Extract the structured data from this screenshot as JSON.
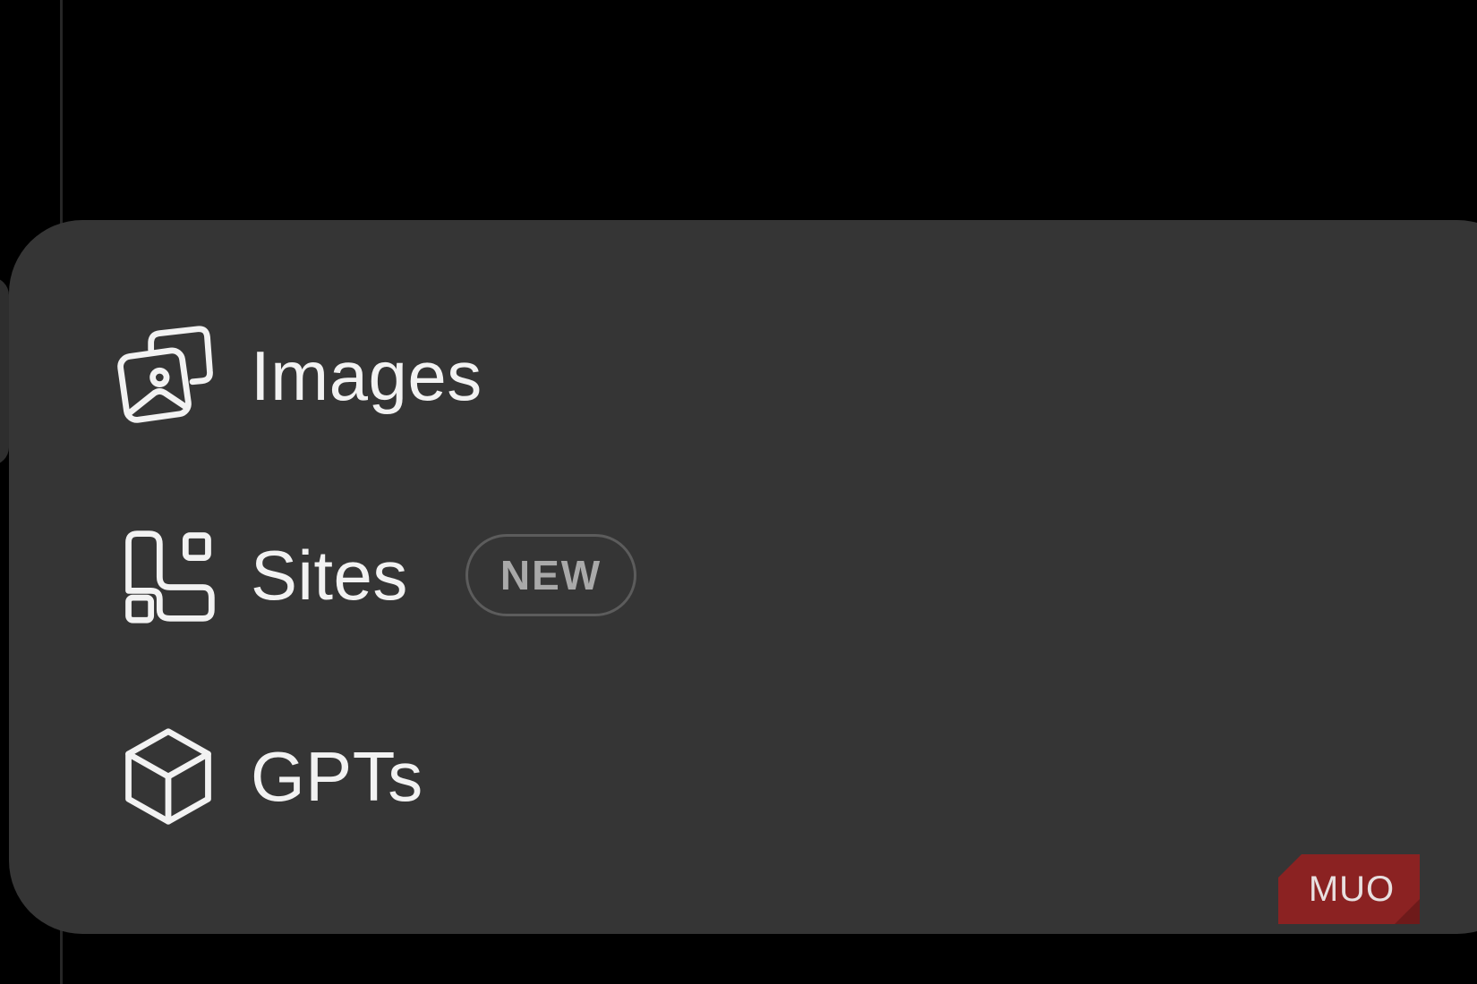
{
  "menu": {
    "items": [
      {
        "label": "Images",
        "icon": "images-icon"
      },
      {
        "label": "Sites",
        "icon": "sites-grid-icon",
        "badge": "NEW"
      },
      {
        "label": "GPTs",
        "icon": "cube-icon"
      }
    ]
  },
  "watermark": {
    "text": "MUO",
    "color": "#8b2222"
  },
  "colors": {
    "background": "#000000",
    "panel": "#353535",
    "text": "#f2f2f2",
    "badge_text": "#a9a9a9",
    "badge_border": "#5c5c5c"
  }
}
